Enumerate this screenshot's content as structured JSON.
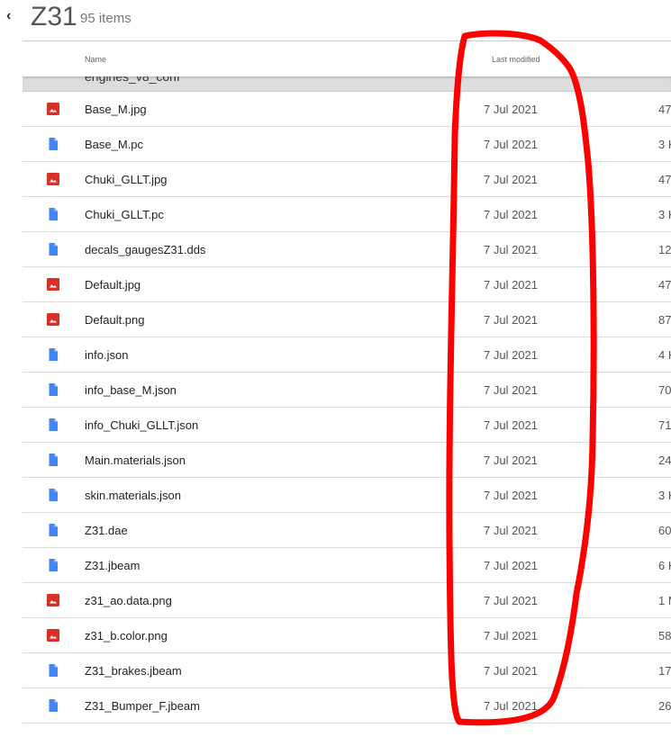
{
  "header": {
    "back": "‹",
    "title": "Z31",
    "count": "95 items"
  },
  "columns": {
    "name": "Name",
    "modified": "Last modified"
  },
  "partial_row": "engines_v8_conf",
  "colors": {
    "image": "#d93025",
    "doc": "#4285f4",
    "annotation": "#ff0000"
  },
  "rows": [
    {
      "name": "Base_M.jpg",
      "type": "image",
      "modified": "7 Jul 2021",
      "size": "47"
    },
    {
      "name": "Base_M.pc",
      "type": "doc",
      "modified": "7 Jul 2021",
      "size": "3 K"
    },
    {
      "name": "Chuki_GLLT.jpg",
      "type": "image",
      "modified": "7 Jul 2021",
      "size": "47"
    },
    {
      "name": "Chuki_GLLT.pc",
      "type": "doc",
      "modified": "7 Jul 2021",
      "size": "3 K"
    },
    {
      "name": "decals_gaugesZ31.dds",
      "type": "doc",
      "modified": "7 Jul 2021",
      "size": "12"
    },
    {
      "name": "Default.jpg",
      "type": "image",
      "modified": "7 Jul 2021",
      "size": "47"
    },
    {
      "name": "Default.png",
      "type": "image",
      "modified": "7 Jul 2021",
      "size": "87"
    },
    {
      "name": "info.json",
      "type": "doc",
      "modified": "7 Jul 2021",
      "size": "4 K"
    },
    {
      "name": "info_base_M.json",
      "type": "doc",
      "modified": "7 Jul 2021",
      "size": "70"
    },
    {
      "name": "info_Chuki_GLLT.json",
      "type": "doc",
      "modified": "7 Jul 2021",
      "size": "71"
    },
    {
      "name": "Main.materials.json",
      "type": "doc",
      "modified": "7 Jul 2021",
      "size": "24"
    },
    {
      "name": "skin.materials.json",
      "type": "doc",
      "modified": "7 Jul 2021",
      "size": "3 K"
    },
    {
      "name": "Z31.dae",
      "type": "doc",
      "modified": "7 Jul 2021",
      "size": "60"
    },
    {
      "name": "Z31.jbeam",
      "type": "doc",
      "modified": "7 Jul 2021",
      "size": "6 K"
    },
    {
      "name": "z31_ao.data.png",
      "type": "image",
      "modified": "7 Jul 2021",
      "size": "1 M"
    },
    {
      "name": "z31_b.color.png",
      "type": "image",
      "modified": "7 Jul 2021",
      "size": "58"
    },
    {
      "name": "Z31_brakes.jbeam",
      "type": "doc",
      "modified": "7 Jul 2021",
      "size": "17"
    },
    {
      "name": "Z31_Bumper_F.jbeam",
      "type": "doc",
      "modified": "7 Jul 2021",
      "size": "26"
    }
  ]
}
